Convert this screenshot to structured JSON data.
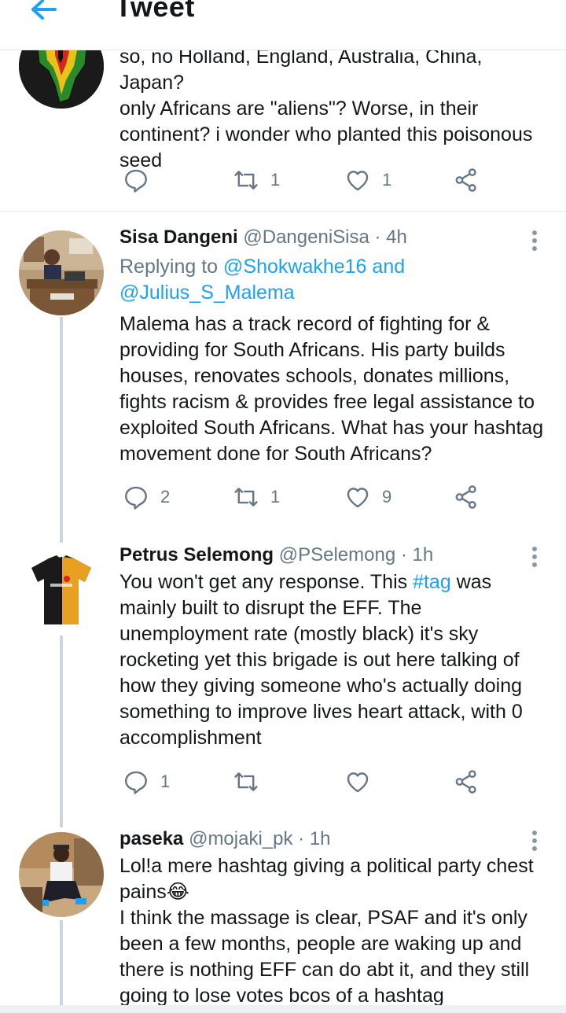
{
  "header": {
    "title": "Tweet"
  },
  "tweets": [
    {
      "text_lines": [
        "so, no Holland, England, Australia, China, Japan?",
        "only Africans are \"aliens\"? Worse, in their",
        "continent? i wonder who planted this poisonous",
        "seed"
      ],
      "actions": {
        "replies": "",
        "retweets": "1",
        "likes": "1"
      }
    },
    {
      "name": "Sisa Dangeni",
      "handle": "@DangeniSisa",
      "time": "· 4h",
      "replying_prefix": "Replying to",
      "replying_line1": "@Shokwakhe16 and",
      "replying_line2": "@Julius_S_Malema",
      "text_lines": [
        "Malema has a track record of fighting for &",
        "providing for South Africans. His party builds",
        "houses, renovates schools, donates millions,",
        "fights racism & provides free legal assistance to",
        "exploited South Africans. What has your hashtag",
        "movement done for South Africans?"
      ],
      "actions": {
        "replies": "2",
        "retweets": "1",
        "likes": "9"
      }
    },
    {
      "name": "Petrus Selemong",
      "handle": "@PSelemong",
      "time": "· 1h",
      "text_line1_before": "You won't get any response. This ",
      "hashtag": "#tag",
      "text_line1_after": " was",
      "text_lines": [
        "mainly built to disrupt the EFF. The",
        "unemployment rate (mostly black) it's sky",
        "rocketing yet this brigade is out here talking of",
        "how they giving someone who's actually doing",
        "something to improve lives heart attack, with 0",
        "accomplishment"
      ],
      "actions": {
        "replies": "1",
        "retweets": "",
        "likes": ""
      }
    },
    {
      "name": "paseka",
      "handle": "@mojaki_pk",
      "time": "· 1h",
      "text_lines": [
        "Lol!a mere hashtag giving a political party chest",
        "pains😂",
        "I think the massage is clear, PSAF and it's only",
        "been a few months, people are waking up and",
        "there is nothing EFF can do abt it, and they still",
        "going to lose votes bcos of a hashtag"
      ]
    }
  ],
  "colors": {
    "accent": "#1da1f2",
    "secondary_text": "#657786",
    "icon_gray": "#657786",
    "divider": "#e1e8ed"
  }
}
